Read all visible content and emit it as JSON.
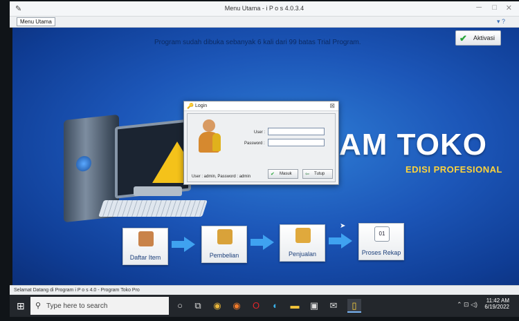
{
  "window": {
    "title": "Menu Utama - i P o s 4.0.3.4",
    "minimize": "─",
    "maximize": "□",
    "close": "✕"
  },
  "menu": {
    "items": [
      "Menu Utama"
    ],
    "help_icons": "▾ ?"
  },
  "main": {
    "trial_message": "Program sudah dibuka sebanyak 6 kali dari 99 batas Trial Program.",
    "aktivasi_label": "Aktivasi",
    "brand_title": "AM TOKO",
    "brand_subtitle": "EDISI PROFESIONAL"
  },
  "login": {
    "title": "Login",
    "user_label": "User :",
    "password_label": "Password :",
    "user_value": "",
    "password_value": "",
    "hint": "User : admin, Password : admin",
    "masuk_label": "Masuk",
    "tutup_label": "Tutup"
  },
  "flow": [
    {
      "label": "Daftar Item",
      "icon": "box-icon",
      "color": "#c9834a"
    },
    {
      "label": "Pembelian",
      "icon": "coins-plus-icon",
      "color": "#5a9c3a"
    },
    {
      "label": "Penjualan",
      "icon": "coins-minus-icon",
      "color": "#d9a23a"
    },
    {
      "label": "Proses Rekap",
      "icon": "calendar-icon",
      "color": "#4b8f4b"
    }
  ],
  "flow_calendar_text": "01",
  "status_bar": {
    "text": "Selamat Datang di Program i P o s 4.0 - Program Toko Pro"
  },
  "taskbar": {
    "search_placeholder": "Type here to search",
    "time": "11:42 AM",
    "date": "6/19/2022",
    "tray": "⌃ ⊡ ◁)"
  },
  "colors": {
    "background_accent": "#1c56b8",
    "brand_yellow": "#ffd43b",
    "arrow_blue": "#3fa2f0"
  }
}
